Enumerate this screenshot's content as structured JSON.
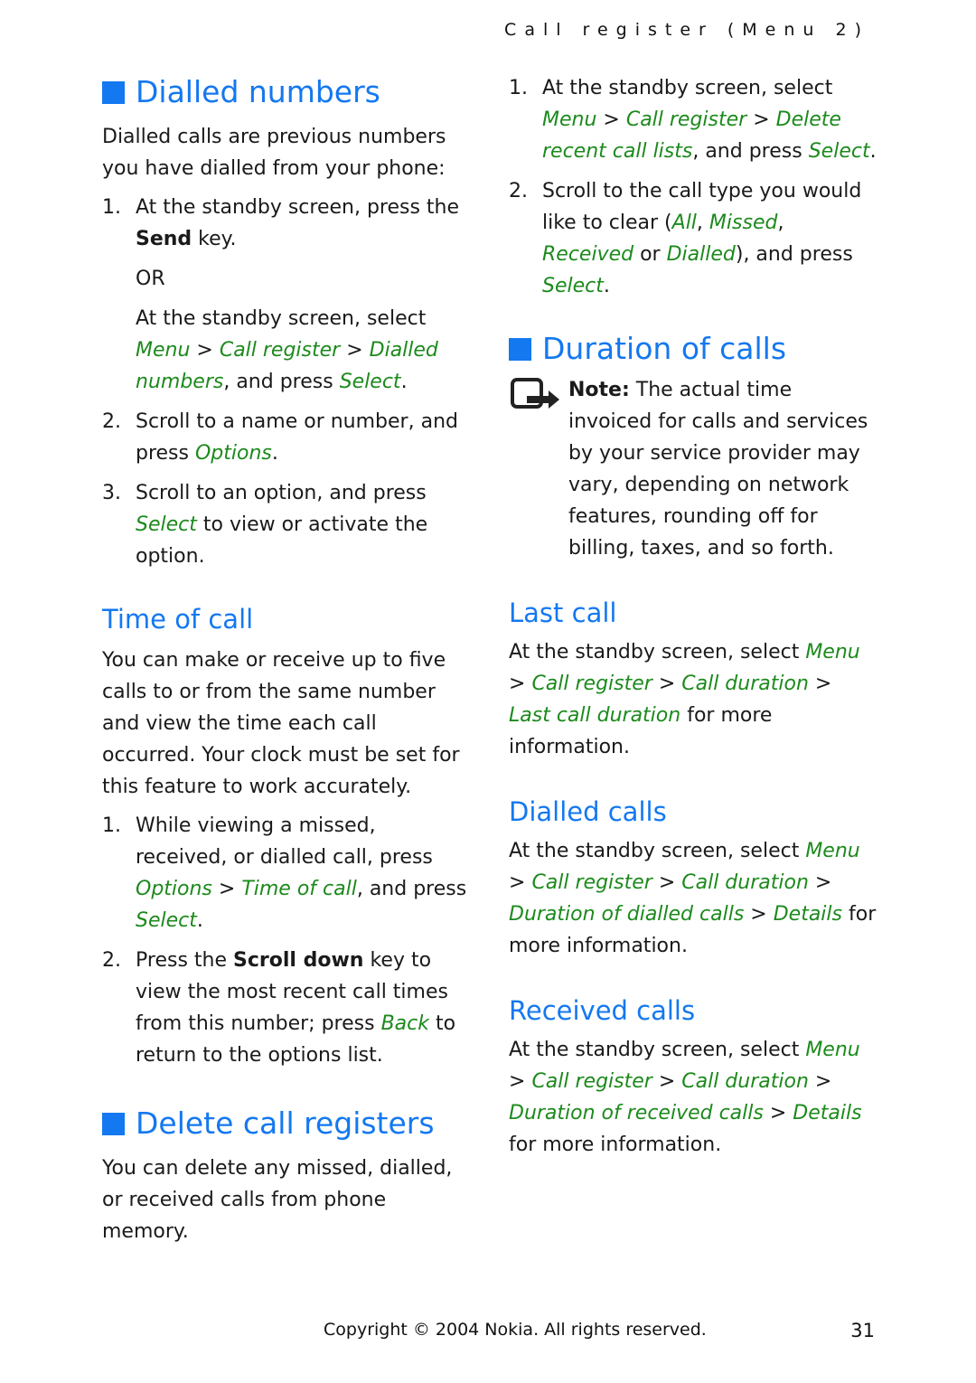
{
  "running_head": "Call register (Menu 2)",
  "left": {
    "dialled_numbers": {
      "title": "Dialled numbers",
      "intro": "Dialled calls are previous numbers you have dialled from your phone:",
      "step1_num": "1.",
      "step1_a": "At the standby screen, press the ",
      "step1_key": "Send",
      "step1_b": " key.",
      "or": "OR",
      "alt_a": "At the standby screen, select ",
      "alt_menu": "Menu",
      "alt_sep1": " > ",
      "alt_callreg": "Call register",
      "alt_sep2": " > ",
      "alt_dialled": "Dialled numbers",
      "alt_b": ", and press ",
      "alt_select": "Select",
      "alt_end": ".",
      "step2_num": "2.",
      "step2_a": "Scroll to a name or number, and press ",
      "step2_options": "Options",
      "step2_end": ".",
      "step3_num": "3.",
      "step3_a": "Scroll to an option, and press ",
      "step3_select": "Select",
      "step3_b": " to view or activate the option."
    },
    "time_of_call": {
      "title": "Time of call",
      "intro": "You can make or receive up to five calls to or from the same number and view the time each call occurred. Your clock must be set for this feature to work accurately.",
      "step1_num": "1.",
      "step1_a": "While viewing a missed, received, or dialled call, press ",
      "step1_options": "Options",
      "step1_sep": " > ",
      "step1_toc": "Time of call",
      "step1_b": ", and press ",
      "step1_select": "Select",
      "step1_end": ".",
      "step2_num": "2.",
      "step2_a": "Press the ",
      "step2_key": "Scroll down",
      "step2_b": " key to view the most recent call times from this number; press ",
      "step2_back": "Back",
      "step2_c": " to return to the options list."
    },
    "delete": {
      "title": "Delete call registers",
      "intro": "You can delete any missed, dialled, or received calls from phone memory."
    }
  },
  "right": {
    "delete_steps": {
      "step1_num": "1.",
      "step1_a": "At the standby screen, select ",
      "step1_menu": "Menu",
      "step1_sep1": " > ",
      "step1_callreg": "Call register",
      "step1_sep2": " > ",
      "step1_delete": "Delete recent call lists",
      "step1_b": ", and press ",
      "step1_select": "Select",
      "step1_end": ".",
      "step2_num": "2.",
      "step2_a": "Scroll to the call type you would like to clear (",
      "step2_all": "All",
      "step2_c1": ", ",
      "step2_missed": "Missed",
      "step2_c2": ", ",
      "step2_received": "Received",
      "step2_or": " or ",
      "step2_dialled": "Dialled",
      "step2_b": "), and press ",
      "step2_select": "Select",
      "step2_end": "."
    },
    "duration": {
      "title": "Duration of calls",
      "note_label": "Note:",
      "note_text": " The actual time invoiced for calls and services by your service provider may vary, depending on network features, rounding off for billing, taxes, and so forth."
    },
    "last_call": {
      "title": "Last call",
      "a": "At the standby screen, select ",
      "menu": "Menu",
      "sep1": " > ",
      "callreg": "Call register",
      "sep2": " > ",
      "calldur": "Call duration",
      "sep3": " > ",
      "last": "Last call duration",
      "b": " for more information."
    },
    "dialled_calls": {
      "title": "Dialled calls",
      "a": "At the standby screen, select ",
      "menu": "Menu",
      "sep1": " > ",
      "callreg": "Call register",
      "sep2": " > ",
      "calldur": "Call duration",
      "sep3": " > ",
      "dur": "Duration of dialled calls",
      "sep4": " > ",
      "details": "Details",
      "b": " for more information."
    },
    "received_calls": {
      "title": "Received calls",
      "a": "At the standby screen, select ",
      "menu": "Menu",
      "sep1": " > ",
      "callreg": "Call register",
      "sep2": " > ",
      "calldur": "Call duration",
      "sep3": " > ",
      "dur": "Duration of received calls",
      "sep4": " > ",
      "details": "Details",
      "b": " for more information."
    }
  },
  "footer": {
    "copyright": "Copyright © 2004 Nokia. All rights reserved.",
    "page_number": "31"
  },
  "colors": {
    "heading": "#1478f0",
    "menu_path": "#1c8a1c",
    "text": "#1a1a1a"
  }
}
